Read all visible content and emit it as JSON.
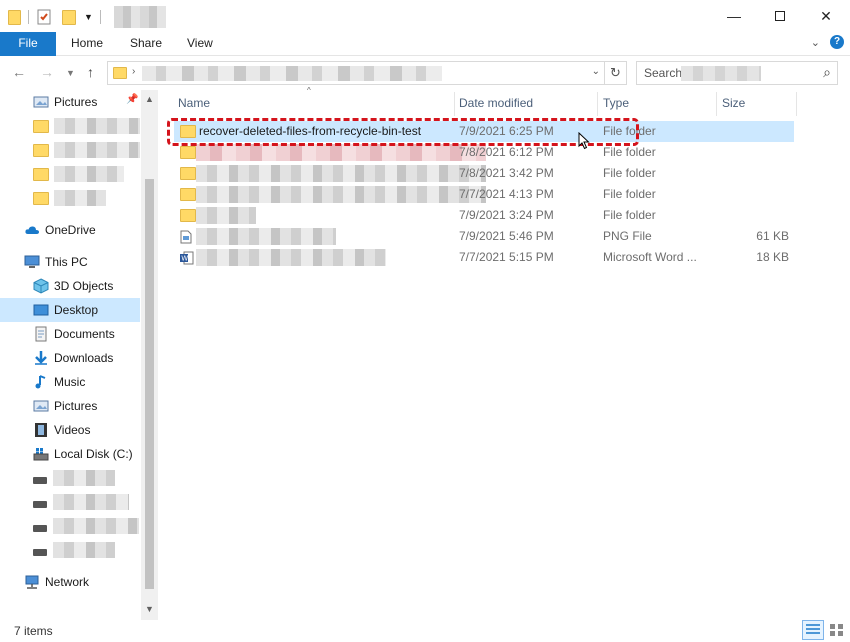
{
  "ribbon": {
    "tabs": [
      "File",
      "Home",
      "Share",
      "View"
    ]
  },
  "search": {
    "placeholder": "Search"
  },
  "nav": {
    "quick_access_pictures": "Pictures",
    "onedrive": "OneDrive",
    "this_pc": "This PC",
    "items": [
      "3D Objects",
      "Desktop",
      "Documents",
      "Downloads",
      "Music",
      "Pictures",
      "Videos",
      "Local Disk (C:)"
    ],
    "network": "Network"
  },
  "columns": {
    "name": "Name",
    "date": "Date modified",
    "type": "Type",
    "size": "Size"
  },
  "files": [
    {
      "name": "recover-deleted-files-from-recycle-bin-test",
      "date": "7/9/2021 6:25 PM",
      "type": "File folder",
      "size": ""
    },
    {
      "name": "",
      "date": "7/8/2021 6:12 PM",
      "type": "File folder",
      "size": ""
    },
    {
      "name": "",
      "date": "7/8/2021 3:42 PM",
      "type": "File folder",
      "size": ""
    },
    {
      "name": "",
      "date": "7/7/2021 4:13 PM",
      "type": "File folder",
      "size": ""
    },
    {
      "name": "",
      "date": "7/9/2021 3:24 PM",
      "type": "File folder",
      "size": ""
    },
    {
      "name": "",
      "date": "7/9/2021 5:46 PM",
      "type": "PNG File",
      "size": "61 KB"
    },
    {
      "name": "",
      "date": "7/7/2021 5:15 PM",
      "type": "Microsoft Word ...",
      "size": "18 KB"
    }
  ],
  "status": {
    "count": "7 items"
  },
  "colors": {
    "accent": "#1979ca",
    "selection": "#cce8ff",
    "highlight": "#d4141c"
  }
}
